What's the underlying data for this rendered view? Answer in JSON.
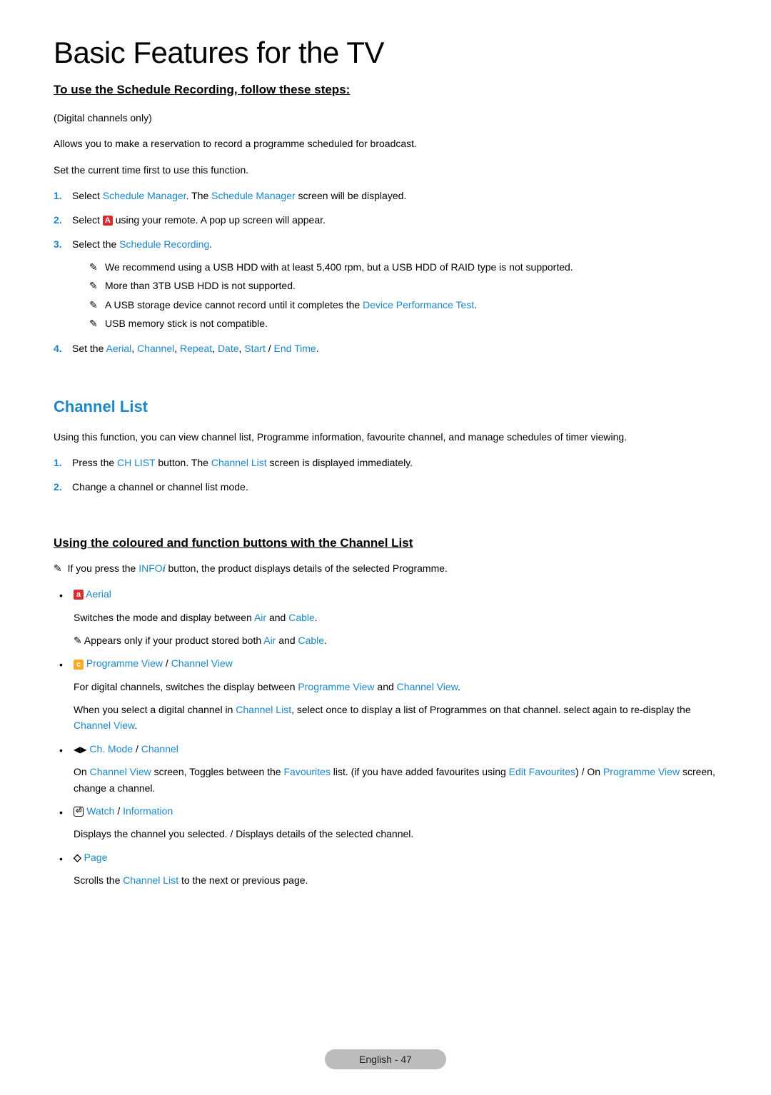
{
  "main_title": "Basic Features for the TV",
  "schedule_section": {
    "heading": "To use the Schedule Recording, follow these steps:",
    "note_digital": "(Digital channels only)",
    "intro1": "Allows you to make a reservation to record a programme scheduled for broadcast.",
    "intro2": "Set the current time first to use this function.",
    "steps": {
      "s1_num": "1.",
      "s1_pre": "Select ",
      "s1_link1": "Schedule Manager",
      "s1_mid": ". The ",
      "s1_link2": "Schedule Manager",
      "s1_post": " screen will be displayed.",
      "s2_num": "2.",
      "s2_pre": "Select ",
      "s2_btn": "A",
      "s2_post": " using your remote. A pop up screen will appear.",
      "s3_num": "3.",
      "s3_pre": "Select the ",
      "s3_link": "Schedule Recording",
      "s3_post": ".",
      "notes": {
        "n1": "We recommend using a USB HDD with at least 5,400 rpm, but a USB HDD of RAID type is not supported.",
        "n2": "More than 3TB USB HDD is not supported.",
        "n3_pre": "A USB storage device cannot record until it completes the ",
        "n3_link": "Device Performance Test",
        "n3_post": ".",
        "n4": "USB memory stick is not compatible."
      },
      "s4_num": "4.",
      "s4_pre": "Set the ",
      "s4_l1": "Aerial",
      "s4_c1": ", ",
      "s4_l2": "Channel",
      "s4_c2": ", ",
      "s4_l3": "Repeat",
      "s4_c3": ", ",
      "s4_l4": "Date",
      "s4_c4": ", ",
      "s4_l5": "Start",
      "s4_slash": " / ",
      "s4_l6": "End Time",
      "s4_post": "."
    }
  },
  "channel_list": {
    "title": "Channel List",
    "intro": "Using this function, you can view channel list, Programme information, favourite channel, and manage schedules of timer viewing.",
    "steps": {
      "s1_num": "1.",
      "s1_pre": "Press the ",
      "s1_link1": "CH LIST",
      "s1_mid": " button. The ",
      "s1_link2": "Channel List",
      "s1_post": " screen is displayed immediately.",
      "s2_num": "2.",
      "s2_text": "Change a channel or channel list mode."
    }
  },
  "coloured_section": {
    "heading": "Using the coloured and function buttons with the Channel List",
    "intro_pre": "If you press the ",
    "intro_info": "INFO",
    "intro_i": "i",
    "intro_post": " button, the product displays details of the selected Programme.",
    "items": {
      "aerial": {
        "btn": "a",
        "label": "Aerial",
        "desc_pre": "Switches the mode and display between ",
        "desc_l1": "Air",
        "desc_and": " and ",
        "desc_l2": "Cable",
        "desc_post": ".",
        "note_pre": "Appears only if your product stored both ",
        "note_l1": "Air",
        "note_and": " and ",
        "note_l2": "Cable",
        "note_post": "."
      },
      "progview": {
        "btn": "c",
        "label1": "Programme View",
        "slash": " / ",
        "label2": "Channel View",
        "desc1_pre": "For digital channels, switches the display between ",
        "desc1_l1": "Programme View",
        "desc1_and": " and ",
        "desc1_l2": "Channel View",
        "desc1_post": ".",
        "desc2_pre": "When you select a digital channel in ",
        "desc2_l1": "Channel List",
        "desc2_mid": ", select once to display a list of Programmes on that channel. select again to re-display the ",
        "desc2_l2": "Channel View",
        "desc2_post": "."
      },
      "chmode": {
        "icon": "◀▶",
        "label1": "Ch. Mode",
        "slash": " / ",
        "label2": "Channel",
        "desc_pre": "On ",
        "desc_l1": "Channel View",
        "desc_mid1": " screen, Toggles between the ",
        "desc_l2": "Favourites",
        "desc_mid2": " list. (if you have added favourites using ",
        "desc_l3": "Edit Favourites",
        "desc_mid3": ") / On ",
        "desc_l4": "Programme View",
        "desc_post": " screen, change a channel."
      },
      "watch": {
        "icon": "⏎",
        "label1": "Watch",
        "slash": " / ",
        "label2": "Information",
        "desc": "Displays the channel you selected. / Displays details of the selected channel."
      },
      "page": {
        "icon": "◇",
        "label": "Page",
        "desc_pre": "Scrolls the ",
        "desc_l1": "Channel List",
        "desc_post": " to the next or previous page."
      }
    }
  },
  "footer": {
    "label": "English - 47"
  },
  "note_glyph": "✎"
}
